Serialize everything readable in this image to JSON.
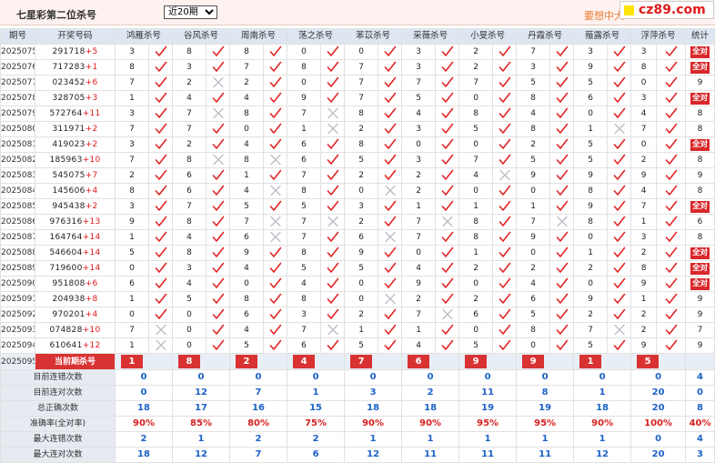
{
  "title": "七星彩第二位杀号",
  "period_select": {
    "selected": "近20期"
  },
  "more_link": "要想中大",
  "logo_text": "cz89.com",
  "colors": {
    "check": "#e02525",
    "cross": "#b9bdc4",
    "accent": "#d93232",
    "stat_blue": "#1c62c8"
  },
  "columns": [
    "期号",
    "开奖号码",
    "鸿雁杀号",
    "谷风杀号",
    "周南杀号",
    "荡之杀号",
    "苯苡杀号",
    "采薇杀号",
    "小旻杀号",
    "丹霞杀号",
    "薤露杀号",
    "浮萍杀号",
    "统计"
  ],
  "rows": [
    {
      "p": "2025075",
      "num": "291718",
      "d": "+5",
      "k": [
        [
          "3",
          1
        ],
        [
          "8",
          1
        ],
        [
          "8",
          1
        ],
        [
          "0",
          1
        ],
        [
          "0",
          1
        ],
        [
          "3",
          1
        ],
        [
          "2",
          1
        ],
        [
          "7",
          1
        ],
        [
          "3",
          1
        ],
        [
          "3",
          1
        ]
      ],
      "t": "全对"
    },
    {
      "p": "2025076",
      "num": "717283",
      "d": "+1",
      "k": [
        [
          "8",
          1
        ],
        [
          "3",
          1
        ],
        [
          "7",
          1
        ],
        [
          "8",
          1
        ],
        [
          "7",
          1
        ],
        [
          "3",
          1
        ],
        [
          "2",
          1
        ],
        [
          "3",
          1
        ],
        [
          "9",
          1
        ],
        [
          "8",
          1
        ]
      ],
      "t": "全对"
    },
    {
      "p": "2025077",
      "num": "023452",
      "d": "+6",
      "k": [
        [
          "7",
          1
        ],
        [
          "2",
          0
        ],
        [
          "2",
          1
        ],
        [
          "0",
          1
        ],
        [
          "7",
          1
        ],
        [
          "7",
          1
        ],
        [
          "7",
          1
        ],
        [
          "5",
          1
        ],
        [
          "5",
          1
        ],
        [
          "0",
          1
        ]
      ],
      "t": "9"
    },
    {
      "p": "2025078",
      "num": "328705",
      "d": "+3",
      "k": [
        [
          "1",
          1
        ],
        [
          "4",
          1
        ],
        [
          "4",
          1
        ],
        [
          "9",
          1
        ],
        [
          "7",
          1
        ],
        [
          "5",
          1
        ],
        [
          "0",
          1
        ],
        [
          "8",
          1
        ],
        [
          "6",
          1
        ],
        [
          "3",
          1
        ]
      ],
      "t": "全对"
    },
    {
      "p": "2025079",
      "num": "572764",
      "d": "+11",
      "k": [
        [
          "3",
          1
        ],
        [
          "7",
          0
        ],
        [
          "8",
          1
        ],
        [
          "7",
          0
        ],
        [
          "8",
          1
        ],
        [
          "4",
          1
        ],
        [
          "8",
          1
        ],
        [
          "4",
          1
        ],
        [
          "0",
          1
        ],
        [
          "4",
          1
        ]
      ],
      "t": "8"
    },
    {
      "p": "2025080",
      "num": "311971",
      "d": "+2",
      "k": [
        [
          "7",
          1
        ],
        [
          "7",
          1
        ],
        [
          "0",
          1
        ],
        [
          "1",
          0
        ],
        [
          "2",
          1
        ],
        [
          "3",
          1
        ],
        [
          "5",
          1
        ],
        [
          "8",
          1
        ],
        [
          "1",
          0
        ],
        [
          "7",
          1
        ]
      ],
      "t": "8"
    },
    {
      "p": "2025081",
      "num": "419023",
      "d": "+2",
      "k": [
        [
          "3",
          1
        ],
        [
          "2",
          1
        ],
        [
          "4",
          1
        ],
        [
          "6",
          1
        ],
        [
          "8",
          1
        ],
        [
          "0",
          1
        ],
        [
          "0",
          1
        ],
        [
          "2",
          1
        ],
        [
          "5",
          1
        ],
        [
          "0",
          1
        ]
      ],
      "t": "全对"
    },
    {
      "p": "2025082",
      "num": "185963",
      "d": "+10",
      "k": [
        [
          "7",
          1
        ],
        [
          "8",
          0
        ],
        [
          "8",
          0
        ],
        [
          "6",
          1
        ],
        [
          "5",
          1
        ],
        [
          "3",
          1
        ],
        [
          "7",
          1
        ],
        [
          "5",
          1
        ],
        [
          "5",
          1
        ],
        [
          "2",
          1
        ]
      ],
      "t": "8"
    },
    {
      "p": "2025083",
      "num": "545075",
      "d": "+7",
      "k": [
        [
          "2",
          1
        ],
        [
          "6",
          1
        ],
        [
          "1",
          1
        ],
        [
          "7",
          1
        ],
        [
          "2",
          1
        ],
        [
          "2",
          1
        ],
        [
          "4",
          0
        ],
        [
          "9",
          1
        ],
        [
          "9",
          1
        ],
        [
          "9",
          1
        ]
      ],
      "t": "9"
    },
    {
      "p": "2025084",
      "num": "145606",
      "d": "+4",
      "k": [
        [
          "8",
          1
        ],
        [
          "6",
          1
        ],
        [
          "4",
          0
        ],
        [
          "8",
          1
        ],
        [
          "0",
          0
        ],
        [
          "2",
          1
        ],
        [
          "0",
          1
        ],
        [
          "0",
          1
        ],
        [
          "8",
          1
        ],
        [
          "4",
          1
        ]
      ],
      "t": "8"
    },
    {
      "p": "2025085",
      "num": "945438",
      "d": "+2",
      "k": [
        [
          "3",
          1
        ],
        [
          "7",
          1
        ],
        [
          "5",
          1
        ],
        [
          "5",
          1
        ],
        [
          "3",
          1
        ],
        [
          "1",
          1
        ],
        [
          "1",
          1
        ],
        [
          "1",
          1
        ],
        [
          "9",
          1
        ],
        [
          "7",
          1
        ]
      ],
      "t": "全对"
    },
    {
      "p": "2025086",
      "num": "976316",
      "d": "+13",
      "k": [
        [
          "9",
          1
        ],
        [
          "8",
          1
        ],
        [
          "7",
          0
        ],
        [
          "7",
          0
        ],
        [
          "2",
          1
        ],
        [
          "7",
          0
        ],
        [
          "8",
          1
        ],
        [
          "7",
          0
        ],
        [
          "8",
          1
        ],
        [
          "1",
          1
        ]
      ],
      "t": "6"
    },
    {
      "p": "2025087",
      "num": "164764",
      "d": "+14",
      "k": [
        [
          "1",
          1
        ],
        [
          "4",
          1
        ],
        [
          "6",
          0
        ],
        [
          "7",
          1
        ],
        [
          "6",
          0
        ],
        [
          "7",
          1
        ],
        [
          "8",
          1
        ],
        [
          "9",
          1
        ],
        [
          "0",
          1
        ],
        [
          "3",
          1
        ]
      ],
      "t": "8"
    },
    {
      "p": "2025088",
      "num": "546604",
      "d": "+14",
      "k": [
        [
          "5",
          1
        ],
        [
          "8",
          1
        ],
        [
          "9",
          1
        ],
        [
          "8",
          1
        ],
        [
          "9",
          1
        ],
        [
          "0",
          1
        ],
        [
          "1",
          1
        ],
        [
          "0",
          1
        ],
        [
          "1",
          1
        ],
        [
          "2",
          1
        ]
      ],
      "t": "全对"
    },
    {
      "p": "2025089",
      "num": "719600",
      "d": "+14",
      "k": [
        [
          "0",
          1
        ],
        [
          "3",
          1
        ],
        [
          "4",
          1
        ],
        [
          "5",
          1
        ],
        [
          "5",
          1
        ],
        [
          "4",
          1
        ],
        [
          "2",
          1
        ],
        [
          "2",
          1
        ],
        [
          "2",
          1
        ],
        [
          "8",
          1
        ]
      ],
      "t": "全对"
    },
    {
      "p": "2025090",
      "num": "951808",
      "d": "+6",
      "k": [
        [
          "6",
          1
        ],
        [
          "4",
          1
        ],
        [
          "0",
          1
        ],
        [
          "4",
          1
        ],
        [
          "0",
          1
        ],
        [
          "9",
          1
        ],
        [
          "0",
          1
        ],
        [
          "4",
          1
        ],
        [
          "0",
          1
        ],
        [
          "9",
          1
        ]
      ],
      "t": "全对"
    },
    {
      "p": "2025091",
      "num": "204938",
      "d": "+8",
      "k": [
        [
          "1",
          1
        ],
        [
          "5",
          1
        ],
        [
          "8",
          1
        ],
        [
          "8",
          1
        ],
        [
          "0",
          0
        ],
        [
          "2",
          1
        ],
        [
          "2",
          1
        ],
        [
          "6",
          1
        ],
        [
          "9",
          1
        ],
        [
          "1",
          1
        ]
      ],
      "t": "9"
    },
    {
      "p": "2025092",
      "num": "970201",
      "d": "+4",
      "k": [
        [
          "0",
          1
        ],
        [
          "0",
          1
        ],
        [
          "6",
          1
        ],
        [
          "3",
          1
        ],
        [
          "2",
          1
        ],
        [
          "7",
          0
        ],
        [
          "6",
          1
        ],
        [
          "5",
          1
        ],
        [
          "2",
          1
        ],
        [
          "2",
          1
        ]
      ],
      "t": "9"
    },
    {
      "p": "2025093",
      "num": "074828",
      "d": "+10",
      "k": [
        [
          "7",
          0
        ],
        [
          "0",
          1
        ],
        [
          "4",
          1
        ],
        [
          "7",
          0
        ],
        [
          "1",
          1
        ],
        [
          "1",
          1
        ],
        [
          "0",
          1
        ],
        [
          "8",
          1
        ],
        [
          "7",
          0
        ],
        [
          "2",
          1
        ]
      ],
      "t": "7"
    },
    {
      "p": "2025094",
      "num": "610641",
      "d": "+12",
      "k": [
        [
          "1",
          0
        ],
        [
          "0",
          1
        ],
        [
          "5",
          1
        ],
        [
          "6",
          1
        ],
        [
          "5",
          1
        ],
        [
          "4",
          1
        ],
        [
          "5",
          1
        ],
        [
          "0",
          1
        ],
        [
          "5",
          1
        ],
        [
          "9",
          1
        ]
      ],
      "t": "9"
    }
  ],
  "prediction": {
    "p": "2025095",
    "label": "当前期杀号",
    "values": [
      "1",
      "8",
      "2",
      "4",
      "7",
      "6",
      "9",
      "9",
      "1",
      "5"
    ]
  },
  "stats": [
    {
      "label": "目前连错次数",
      "values": [
        "0",
        "0",
        "0",
        "0",
        "0",
        "0",
        "0",
        "0",
        "0",
        "0",
        "4"
      ]
    },
    {
      "label": "目前连对次数",
      "values": [
        "0",
        "12",
        "7",
        "1",
        "3",
        "2",
        "11",
        "8",
        "1",
        "20",
        "0"
      ]
    },
    {
      "label": "总正确次数",
      "values": [
        "18",
        "17",
        "16",
        "15",
        "18",
        "18",
        "19",
        "19",
        "18",
        "20",
        "8"
      ]
    },
    {
      "label": "准确率(全对率)",
      "values": [
        "90%",
        "85%",
        "80%",
        "75%",
        "90%",
        "90%",
        "95%",
        "95%",
        "90%",
        "100%",
        "40%"
      ],
      "red": true
    },
    {
      "label": "最大连错次数",
      "values": [
        "2",
        "1",
        "2",
        "2",
        "1",
        "1",
        "1",
        "1",
        "1",
        "0",
        "4"
      ]
    },
    {
      "label": "最大连对次数",
      "values": [
        "18",
        "12",
        "7",
        "6",
        "12",
        "11",
        "11",
        "11",
        "12",
        "20",
        "3"
      ]
    }
  ]
}
